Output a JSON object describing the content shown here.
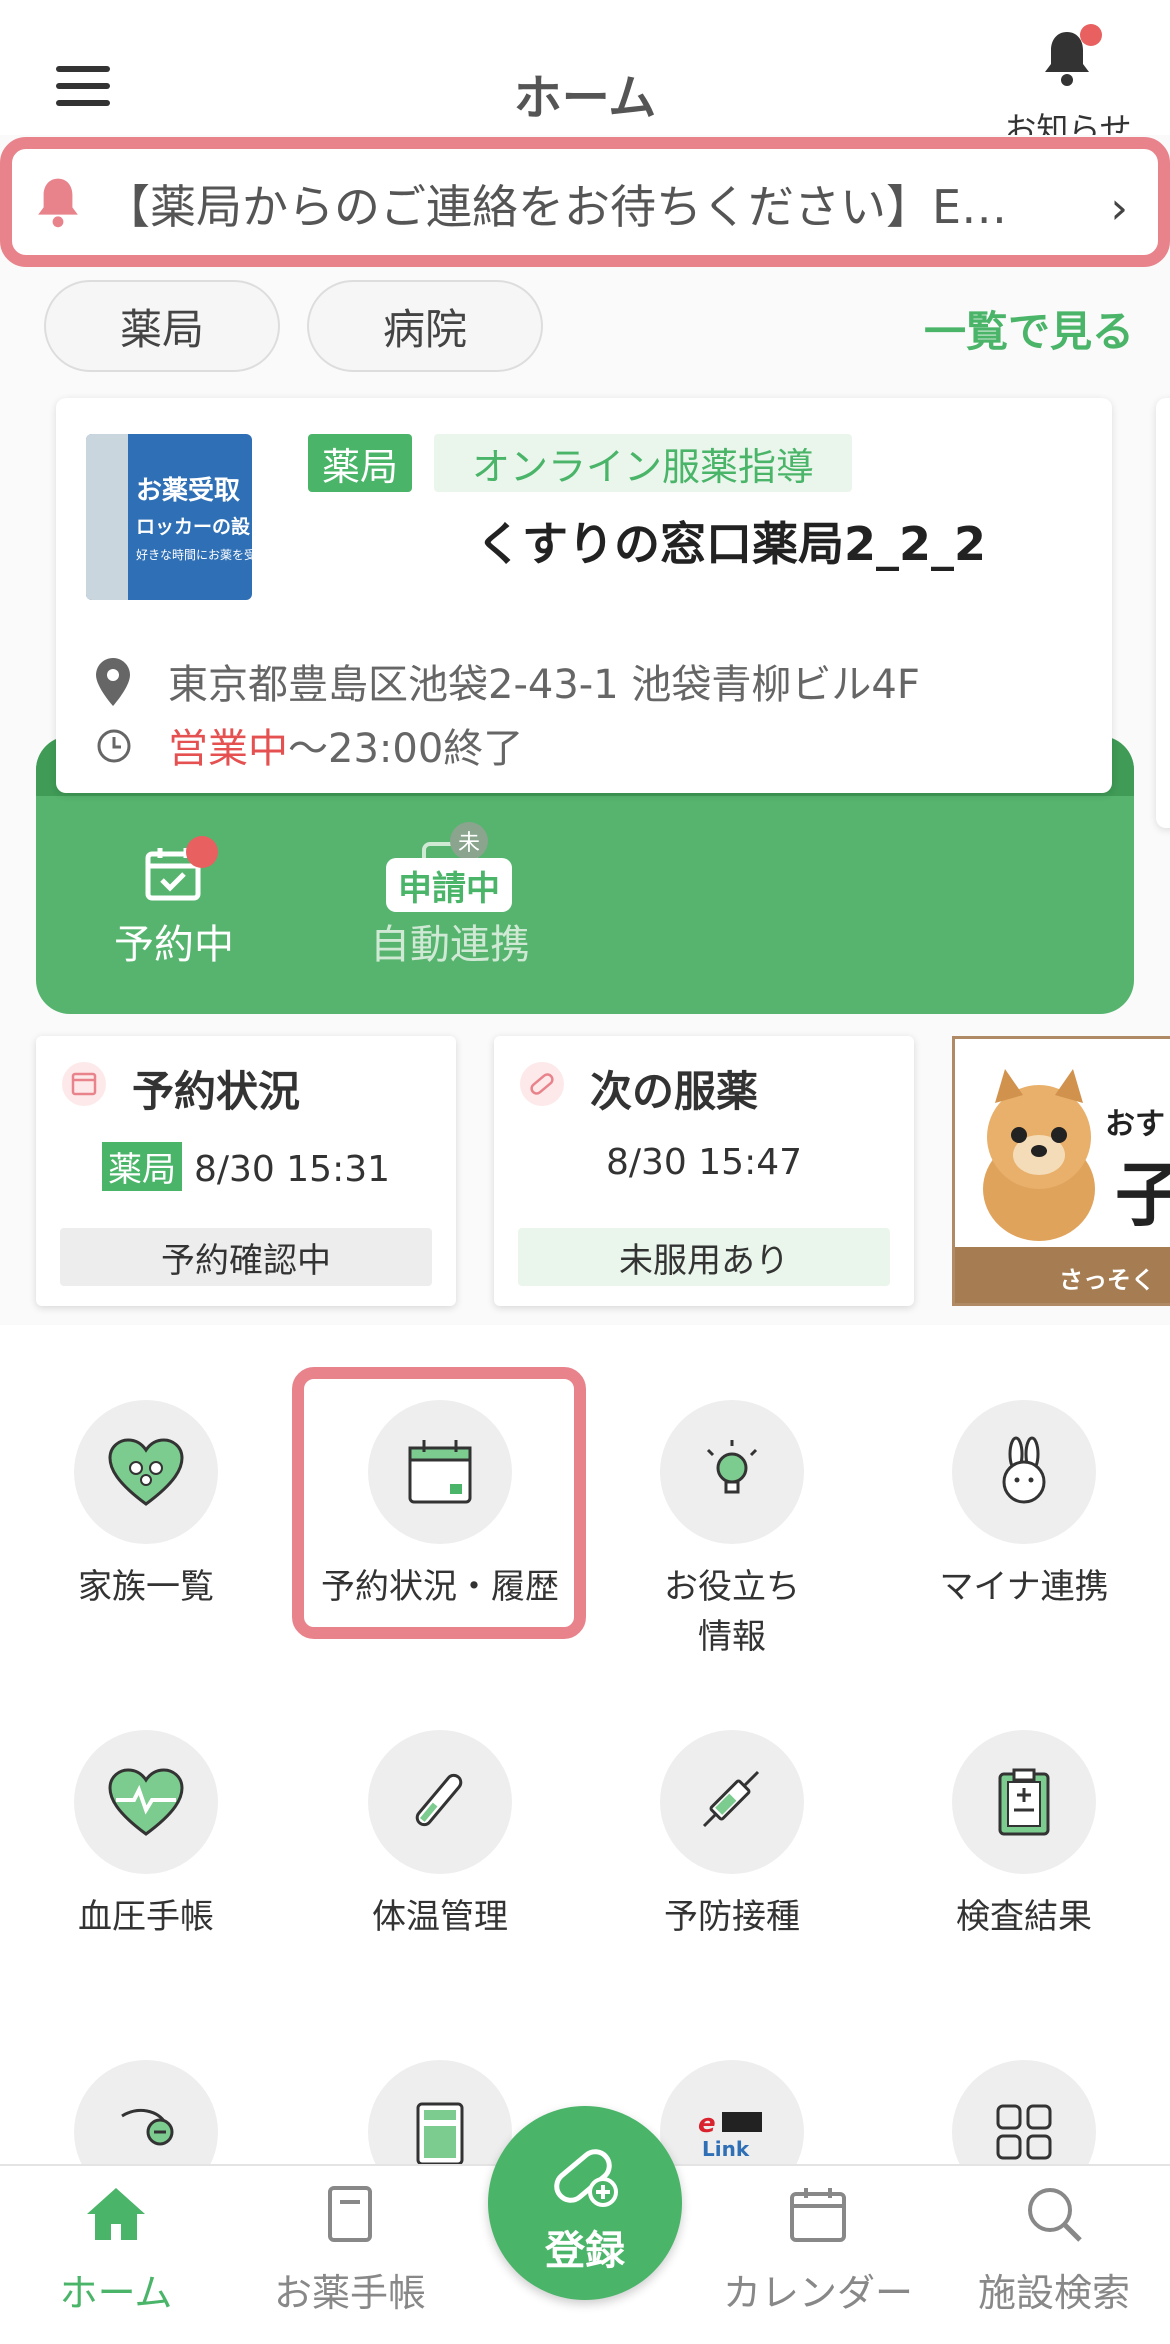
{
  "header": {
    "title": "ホーム",
    "notification_label": "お知らせ"
  },
  "notice": {
    "text": "【薬局からのご連絡をお待ちください】E…"
  },
  "filters": {
    "pharmacy": "薬局",
    "hospital": "病院",
    "see_all": "一覧で見る"
  },
  "facility": {
    "type_tag": "薬局",
    "service_tag": "オンライン服薬指導",
    "name": "くすりの窓口薬局2_2_2",
    "address": "東京都豊島区池袋2-43-1 池袋青柳ビル4F",
    "open_status": "営業中",
    "hours": "〜23:00終了",
    "thumb": {
      "line1": "お薬受取",
      "line2": "ロッカーの設",
      "line3": "好きな時間にお薬を受"
    }
  },
  "actions": {
    "reserve_label": "予約中",
    "link_label": "自動連携",
    "link_badge": "申請中",
    "link_unread": "未"
  },
  "info_cards": {
    "reservation": {
      "title": "予約状況",
      "tag": "薬局",
      "datetime": "8/30 15:31",
      "status": "予約確認中"
    },
    "medication": {
      "title": "次の服薬",
      "datetime": "8/30 15:47",
      "status": "未服用あり"
    }
  },
  "ad": {
    "line1": "おす",
    "line2": "子",
    "bottom": "さっそく"
  },
  "menu": {
    "row1": [
      "家族一覧",
      "予約状況・履歴",
      "お役立ち\n情報",
      "マイナ連携"
    ],
    "row2": [
      "血圧手帳",
      "体温管理",
      "予防接種",
      "検査結果"
    ],
    "row3_icons": [
      "shrimp-icon",
      "calculator-icon",
      "e-yaku-link-icon",
      "grid-icon"
    ]
  },
  "bottom_nav": {
    "home": "ホーム",
    "notebook": "お薬手帳",
    "register": "登録",
    "calendar": "カレンダー",
    "search": "施設検索"
  },
  "colors": {
    "accent": "#4ab469",
    "highlight": "#e8838c",
    "alert": "#e86060"
  }
}
